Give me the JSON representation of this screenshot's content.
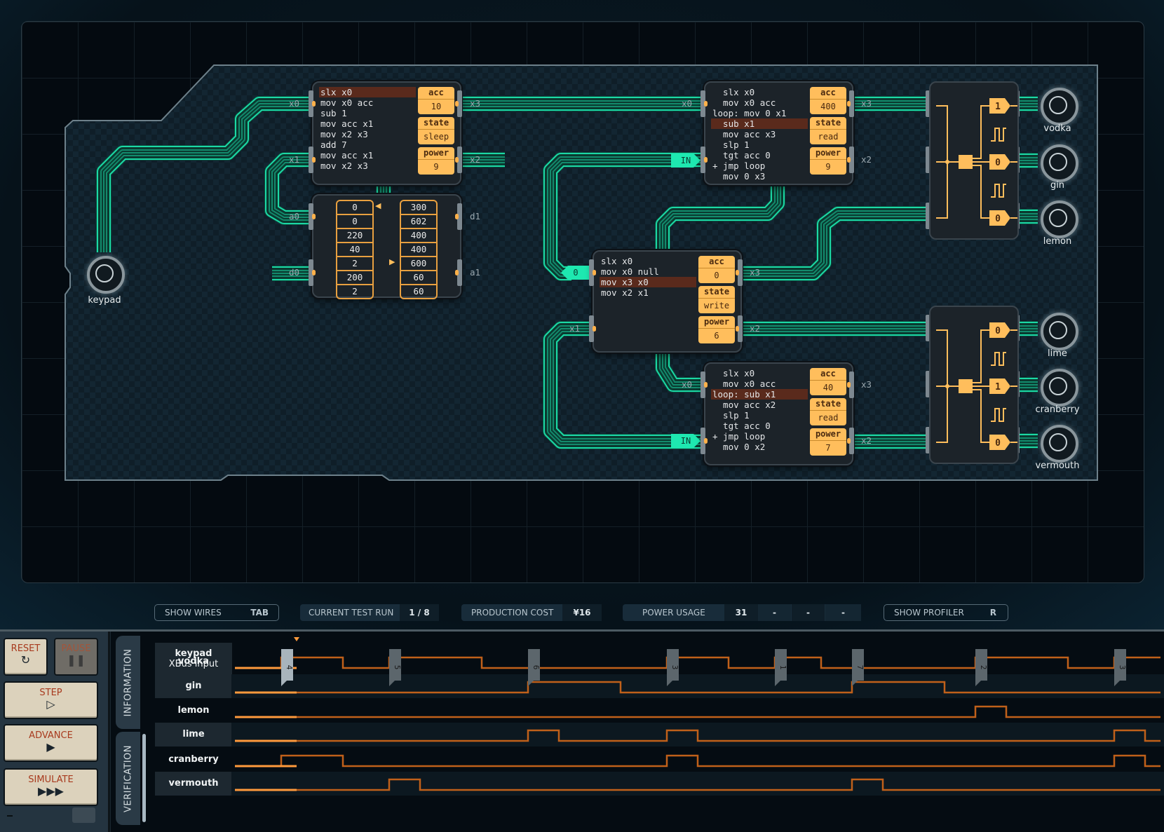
{
  "workspace": {
    "wire_color": "#1ee8b0",
    "accent_orange": "#ffbe5c",
    "keypad": {
      "label": "keypad"
    },
    "controllers": [
      {
        "id": "mc-top-left",
        "code": [
          "slx x0",
          "mov x0 acc",
          "sub 1",
          "mov acc x1",
          "mov x2 x3",
          "add 7",
          "mov acc x1",
          "mov x2 x3"
        ],
        "highlight_line": 0,
        "registers": [
          {
            "key": "acc",
            "value": "10"
          },
          {
            "key": "state",
            "value": "sleep"
          },
          {
            "key": "power",
            "value": "9"
          }
        ],
        "pins_left": [
          "x0",
          "x1"
        ],
        "pins_right": [
          "x3",
          "x2"
        ]
      },
      {
        "id": "mc-top-right",
        "code": [
          "  slx x0",
          "  mov x0 acc",
          "loop: mov 0 x1",
          "  sub x1",
          "  mov acc x3",
          "  slp 1",
          "  tgt acc 0",
          "+ jmp loop",
          "  mov 0 x3"
        ],
        "highlight_line": 3,
        "registers": [
          {
            "key": "acc",
            "value": "400"
          },
          {
            "key": "state",
            "value": "read"
          },
          {
            "key": "power",
            "value": "9"
          }
        ],
        "pins_left": [
          "x0",
          "IN"
        ],
        "pins_right": [
          "x3",
          "x2"
        ]
      },
      {
        "id": "mc-center",
        "code": [
          "slx x0",
          "mov x0 null",
          "mov x3 x0",
          "mov x2 x1"
        ],
        "highlight_line": 2,
        "registers": [
          {
            "key": "acc",
            "value": "0"
          },
          {
            "key": "state",
            "value": "write"
          },
          {
            "key": "power",
            "value": "6"
          }
        ],
        "pins_left": [
          "0",
          "x1"
        ],
        "pins_right": [
          "x3",
          "x2"
        ]
      },
      {
        "id": "mc-bottom",
        "code": [
          "  slx x0",
          "  mov x0 acc",
          "loop: sub x1",
          "  mov acc x2",
          "  slp 1",
          "  tgt acc 0",
          "+ jmp loop",
          "  mov 0 x2"
        ],
        "highlight_line": 2,
        "registers": [
          {
            "key": "acc",
            "value": "40"
          },
          {
            "key": "state",
            "value": "read"
          },
          {
            "key": "power",
            "value": "7"
          }
        ],
        "pins_left": [
          "x0",
          "IN"
        ],
        "pins_right": [
          "x3",
          "x2"
        ]
      }
    ],
    "ram": {
      "pins_left": [
        "a0",
        "d0"
      ],
      "pins_right": [
        "d1",
        "a1"
      ],
      "left_column": [
        "0",
        "0",
        "220",
        "40",
        "2",
        "200",
        "2"
      ],
      "right_column": [
        "300",
        "602",
        "400",
        "400",
        "600",
        "60",
        "60"
      ],
      "left_pointer_row": 0,
      "right_pointer_row": 4
    },
    "output_modules": [
      {
        "values": [
          "1",
          "0",
          "0"
        ]
      },
      {
        "values": [
          "0",
          "1",
          "0"
        ]
      }
    ],
    "speakers": [
      "vodka",
      "gin",
      "lemon",
      "lime",
      "cranberry",
      "vermouth"
    ]
  },
  "status_bar": {
    "show_wires": {
      "label": "SHOW WIRES",
      "key": "TAB"
    },
    "current_test_run": {
      "label": "CURRENT TEST RUN",
      "value": "1 / 8"
    },
    "production_cost": {
      "label": "PRODUCTION COST",
      "value": "¥16"
    },
    "power_usage": {
      "label": "POWER USAGE",
      "value": "31",
      "extra": [
        "-",
        "-",
        "-"
      ]
    },
    "show_profiler": {
      "label": "SHOW PROFILER",
      "key": "R"
    }
  },
  "controls": {
    "reset": "RESET",
    "pause": "PAUSE",
    "step": "STEP",
    "advance": "ADVANCE",
    "simulate": "SIMULATE"
  },
  "tabs": {
    "information": "INFORMATION",
    "verification": "VERIFICATION"
  },
  "timeline": {
    "input_label": "keypad",
    "input_sublabel": "XBus input",
    "current_step": 2,
    "total_steps": 30,
    "markers": [
      {
        "step": 1.5,
        "value": "4"
      },
      {
        "step": 5,
        "value": "5"
      },
      {
        "step": 9.5,
        "value": "6"
      },
      {
        "step": 14,
        "value": "3"
      },
      {
        "step": 17.5,
        "value": "1"
      },
      {
        "step": 20,
        "value": "7"
      },
      {
        "step": 24,
        "value": "2"
      },
      {
        "step": 28.5,
        "value": "3"
      }
    ],
    "signals": [
      {
        "name": "vodka",
        "transitions": [
          [
            0,
            0
          ],
          [
            1.5,
            1
          ],
          [
            3.5,
            0
          ],
          [
            5,
            1
          ],
          [
            8,
            0
          ],
          [
            14,
            1
          ],
          [
            16,
            0
          ],
          [
            17.5,
            1
          ],
          [
            19,
            0
          ],
          [
            24,
            1
          ],
          [
            27,
            0
          ],
          [
            28.5,
            1
          ]
        ]
      },
      {
        "name": "gin",
        "transitions": [
          [
            0,
            0
          ],
          [
            9.5,
            1
          ],
          [
            12.5,
            0
          ],
          [
            20,
            1
          ],
          [
            23,
            0
          ]
        ]
      },
      {
        "name": "lemon",
        "transitions": [
          [
            0,
            0
          ],
          [
            24,
            1
          ],
          [
            25,
            0
          ]
        ]
      },
      {
        "name": "lime",
        "transitions": [
          [
            0,
            0
          ],
          [
            9.5,
            1
          ],
          [
            10.5,
            0
          ],
          [
            14,
            1
          ],
          [
            15,
            0
          ],
          [
            28.5,
            1
          ],
          [
            29.5,
            0
          ]
        ]
      },
      {
        "name": "cranberry",
        "transitions": [
          [
            0,
            0
          ],
          [
            1.5,
            1
          ],
          [
            3.5,
            0
          ],
          [
            14,
            1
          ],
          [
            15,
            0
          ],
          [
            28.5,
            1
          ],
          [
            29.5,
            0
          ]
        ]
      },
      {
        "name": "vermouth",
        "transitions": [
          [
            0,
            0
          ],
          [
            5,
            1
          ],
          [
            6,
            0
          ],
          [
            20,
            1
          ],
          [
            21,
            0
          ]
        ]
      }
    ]
  }
}
